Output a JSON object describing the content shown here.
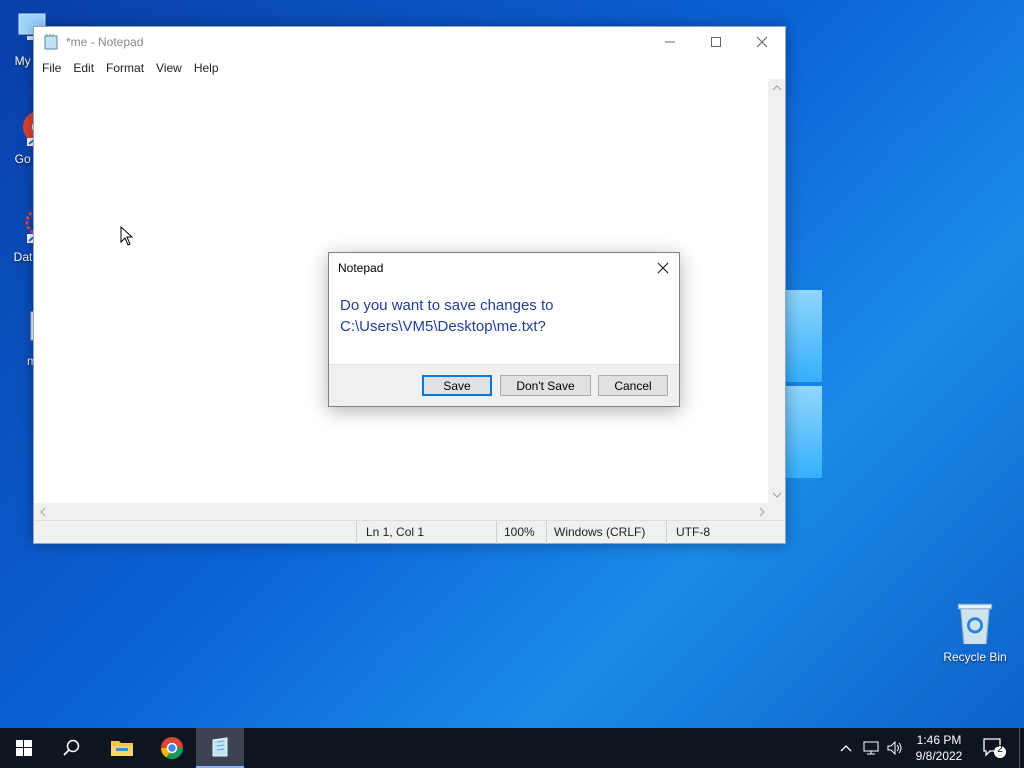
{
  "desktop": {
    "icons": [
      {
        "label": "My Co"
      },
      {
        "label": "Go Ch"
      },
      {
        "label": "DataW"
      },
      {
        "label": "m"
      },
      {
        "label": "Recycle Bin"
      }
    ]
  },
  "notepad": {
    "title": "*me - Notepad",
    "menu": [
      "File",
      "Edit",
      "Format",
      "View",
      "Help"
    ],
    "status": {
      "position": "Ln 1, Col 1",
      "zoom": "100%",
      "line_ending": "Windows (CRLF)",
      "encoding": "UTF-8"
    }
  },
  "dialog": {
    "title": "Notepad",
    "message_line1": "Do you want to save changes to",
    "message_line2": "C:\\Users\\VM5\\Desktop\\me.txt?",
    "buttons": {
      "save": "Save",
      "dont_save": "Don't Save",
      "cancel": "Cancel"
    }
  },
  "taskbar": {
    "time": "1:46 PM",
    "date": "9/8/2022",
    "notifications": "2"
  },
  "colors": {
    "accent": "#0078d7",
    "dialog_text": "#1f3f99"
  }
}
